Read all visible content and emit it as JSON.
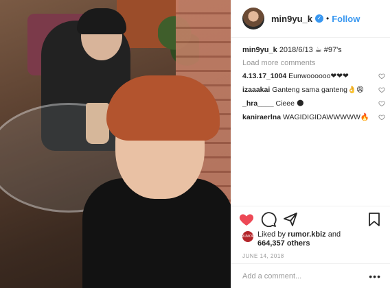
{
  "header": {
    "username": "min9yu_k",
    "verified_icon": "verified-badge-icon",
    "separator": "•",
    "follow_label": "Follow"
  },
  "caption": {
    "username": "min9yu_k",
    "text": "2018/6/13 ☕ #97's"
  },
  "load_more_label": "Load more comments",
  "comments": [
    {
      "username": "4.13.17_1004",
      "text": "Eunwoooooo❤❤❤"
    },
    {
      "username": "izaaakai",
      "text": "Ganteng sama ganteng👌😩"
    },
    {
      "username": "_hra____",
      "text": "Cieee 🌑"
    },
    {
      "username": "kaniraerlna",
      "text": "WAGIDIGIDAWWWWW🔥"
    }
  ],
  "likes": {
    "avatar_text": "RUMOR",
    "prefix": "Liked by",
    "user": "rumor.kbiz",
    "and": "and",
    "count": "664,357 others"
  },
  "date": "JUNE 14, 2018",
  "add_comment": {
    "placeholder": "Add a comment..."
  },
  "more_label": "•••",
  "colors": {
    "accent": "#3897f0",
    "liked_heart": "#ed4956",
    "muted": "#999999"
  },
  "icons": {
    "heart": "heart-icon",
    "comment": "comment-icon",
    "share": "share-icon",
    "bookmark": "bookmark-icon"
  }
}
